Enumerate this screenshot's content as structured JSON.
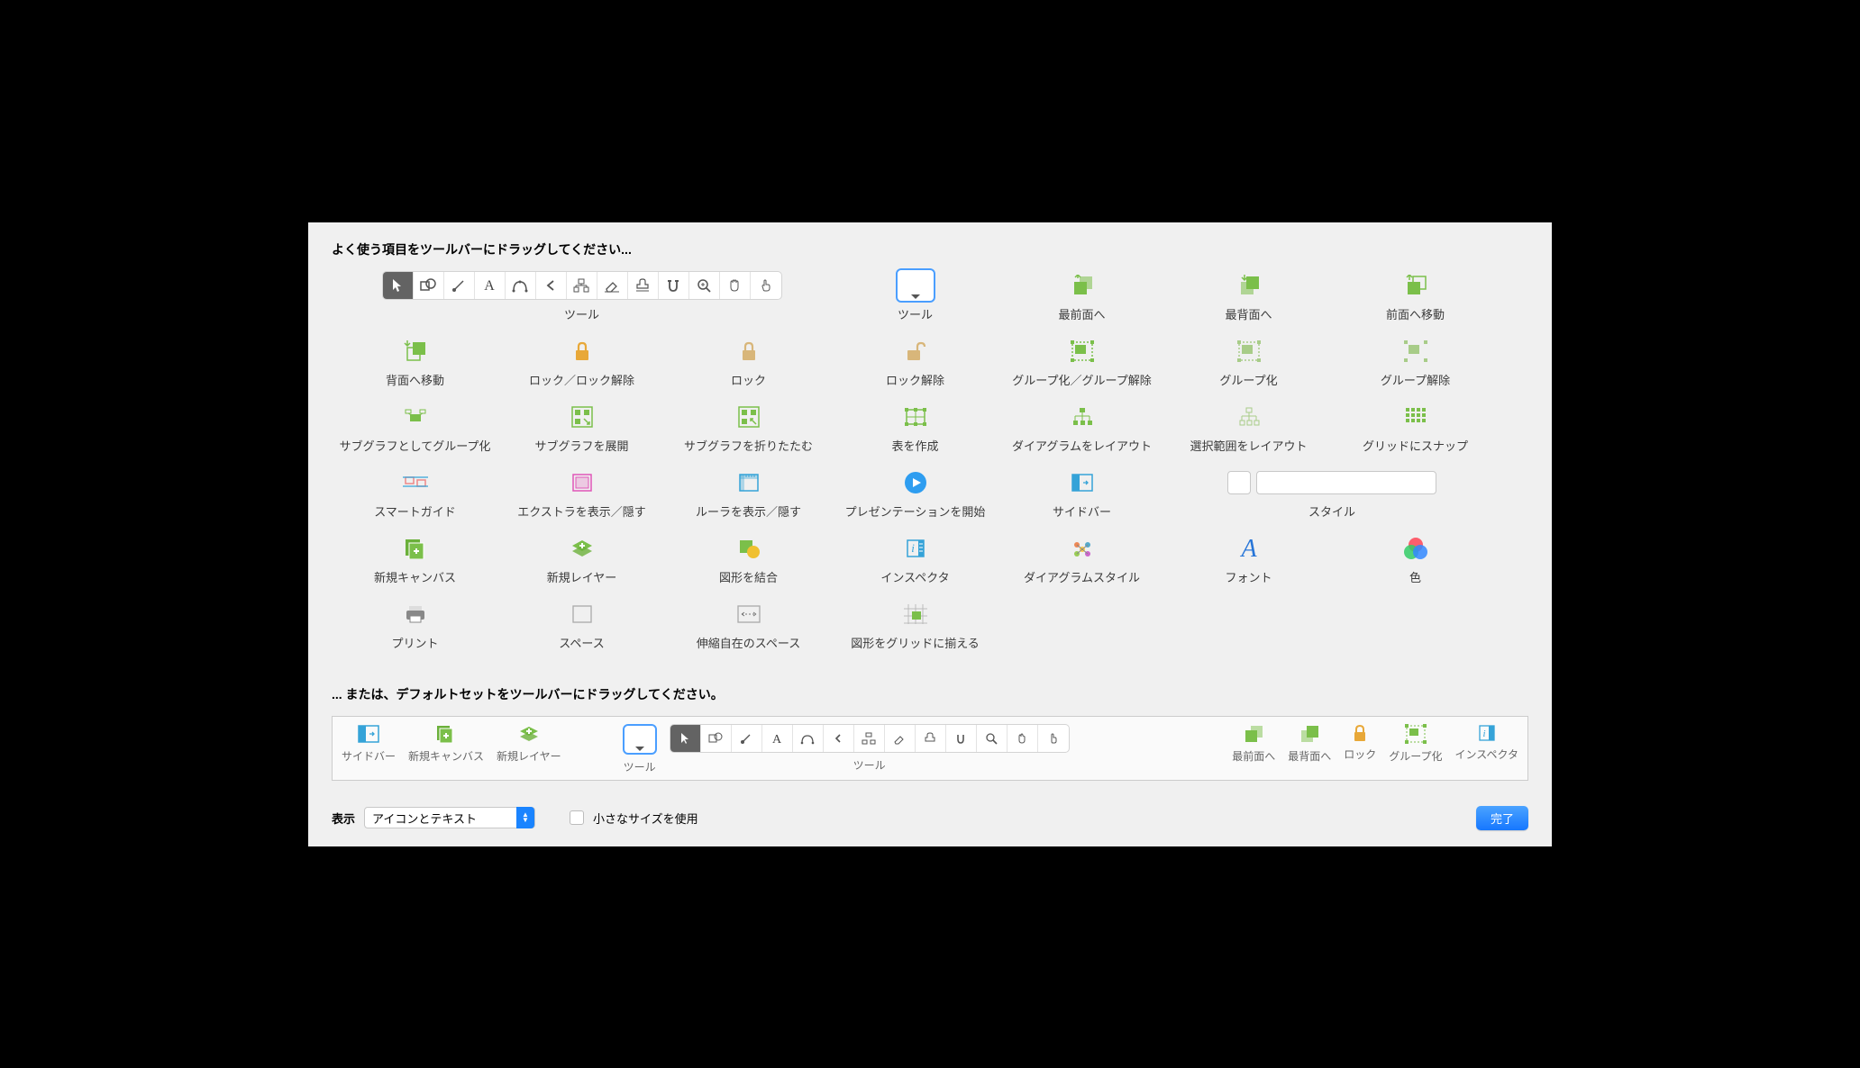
{
  "headings": {
    "drag_favorites": "よく使う項目をツールバーにドラッグしてください...",
    "or_default": "... または、デフォルトセットをツールバーにドラッグしてください。"
  },
  "items": {
    "tools": "ツール",
    "tool_dropdown": "ツール",
    "bring_front": "最前面へ",
    "send_back": "最背面へ",
    "move_forward": "前面へ移動",
    "move_backward": "背面へ移動",
    "lock_unlock": "ロック／ロック解除",
    "lock": "ロック",
    "unlock": "ロック解除",
    "group_ungroup": "グループ化／グループ解除",
    "group": "グループ化",
    "ungroup": "グループ解除",
    "group_as_subgraph": "サブグラフとしてグループ化",
    "expand_subgraph": "サブグラフを展開",
    "collapse_subgraph": "サブグラフを折りたたむ",
    "create_table": "表を作成",
    "layout_diagram": "ダイアグラムをレイアウト",
    "layout_selection": "選択範囲をレイアウト",
    "snap_grid": "グリッドにスナップ",
    "smart_guide": "スマートガイド",
    "show_extras": "エクストラを表示／隠す",
    "show_rulers": "ルーラを表示／隠す",
    "start_presentation": "プレゼンテーションを開始",
    "sidebar": "サイドバー",
    "style": "スタイル",
    "new_canvas": "新規キャンバス",
    "new_layer": "新規レイヤー",
    "combine_shapes": "図形を結合",
    "inspector": "インスペクタ",
    "diagram_style": "ダイアグラムスタイル",
    "font": "フォント",
    "color": "色",
    "print": "プリント",
    "space": "スペース",
    "flex_space": "伸縮自在のスペース",
    "align_to_grid": "図形をグリッドに揃える"
  },
  "defaultset": {
    "sidebar": "サイドバー",
    "new_canvas": "新規キャンバス",
    "new_layer": "新規レイヤー",
    "tool_dd": "ツール",
    "tools": "ツール",
    "bring_front": "最前面へ",
    "send_back": "最背面へ",
    "lock": "ロック",
    "group": "グループ化",
    "inspector": "インスペクタ"
  },
  "bottom": {
    "show_label": "表示",
    "select_value": "アイコンとテキスト",
    "small_size": "小さなサイズを使用",
    "done": "完了"
  }
}
